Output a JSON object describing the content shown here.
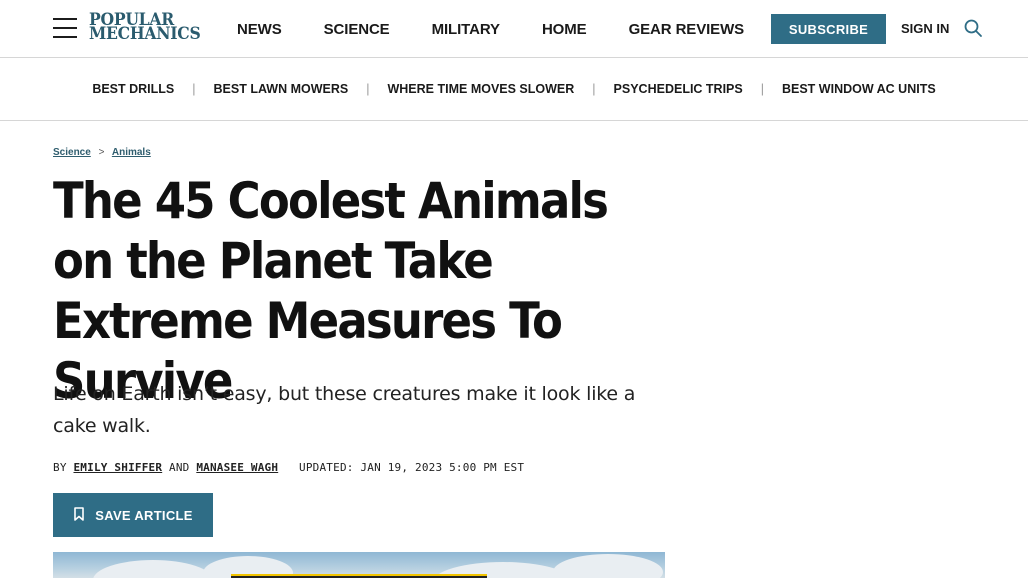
{
  "header": {
    "logo_line1": "POPULAR",
    "logo_line2": "MECHANICS",
    "nav": [
      "NEWS",
      "SCIENCE",
      "MILITARY",
      "HOME",
      "GEAR REVIEWS"
    ],
    "subscribe_label": "SUBSCRIBE",
    "signin_label": "SIGN IN",
    "icons": {
      "menu": "hamburger-menu-icon",
      "search": "search-icon"
    }
  },
  "trending": [
    "BEST DRILLS",
    "BEST LAWN MOWERS",
    "WHERE TIME MOVES SLOWER",
    "PSYCHEDELIC TRIPS",
    "BEST WINDOW AC UNITS"
  ],
  "trending_separator": "|",
  "breadcrumb": {
    "items": [
      "Science",
      "Animals"
    ],
    "separator": ">"
  },
  "article": {
    "title": "The 45 Coolest Animals on the Planet Take Extreme Measures To Survive",
    "dek": "Life on Earth isn’t easy, but these creatures make it look like a cake walk.",
    "byline_prefix": "BY",
    "author1": "EMILY SHIFFER",
    "byline_and": "AND",
    "author2": "MANASEE WAGH",
    "updated": "UPDATED: JAN 19, 2023 5:00 PM EST",
    "save_label": "SAVE ARTICLE"
  },
  "colors": {
    "brand": "#2f6d86",
    "logo": "#2a5b6e",
    "breadcrumb": "#2f5d6e"
  }
}
